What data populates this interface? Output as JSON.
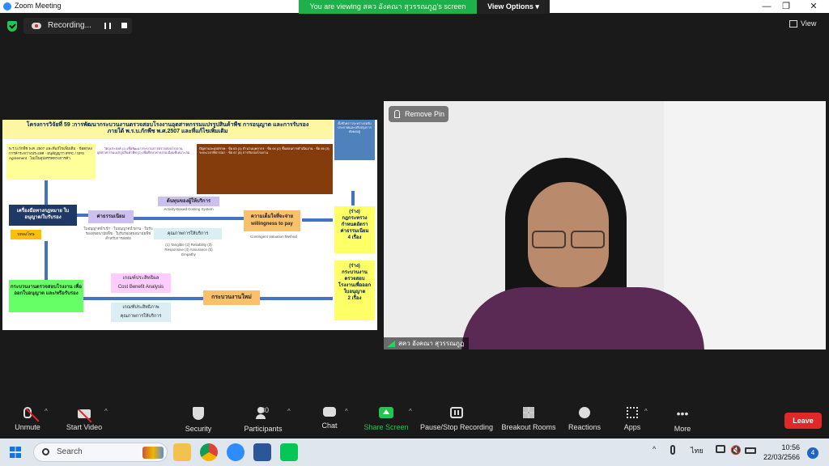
{
  "titlebar": {
    "app_title": "Zoom Meeting",
    "viewing_banner": "You are viewing สคว อังคณา สุวรรณภูฏ's screen",
    "view_options": "View Options",
    "minimize": "—",
    "maximize": "❐",
    "close": "✕"
  },
  "topbar": {
    "recording_label": "Recording...",
    "view_label": "View"
  },
  "slide": {
    "title_line1": "โครงการวิจัยที่ 59 :การพัฒนากระบวนงานตรวจสอบโรงงานอุตสาหกรรมแปรรูปสินค้าพืช การอนุญาต และการรับรอง",
    "title_line2": "ภายใต้ พ.ร.บ.กักพืช พ.ศ.2507 และที่แก้ไขเพิ่มเติม",
    "side_blue": "ตั้งชั่วคราวระหว่างรอรับประกาศและปรับปรุงการยังคงอยู่",
    "yellow_left": "พ.ร.บ.กักพืช พ.ศ. 2507 และที่แก้ไขเพิ่มเติม · ข้อตกลงการค้าระหว่างประเทศ · อนุสัญญาฯ IPPC / SPS Agreement · ไม่เป็นอุปสรรคทางการค้า",
    "objectives": "วัตถุประสงค์ (1) เพื่อพัฒนากระบวนการตรวจสอบโรงงานอุตสาหกรรมแปรรูปสินค้าพืช (2) เพื่อศึกษาค่าธรรมเนียมที่เหมาะสม",
    "problems": "ปัญหาและอุปสรรค · ข้อ 63 (1) จำนวนบุคลากร · ข้อ 64 (2) ขั้นตอนการดำเนินงาน · ข้อ 65 (3) ระยะเวลาพิจารณา · ข้อ 67 (5) การรับรองโรงงาน",
    "law_tool": "เครื่องมือทางกฎหมาย ใบอนุญาต/ใบรับรอง",
    "amend": "บทลงโทษ",
    "fee": "ค่าธรรมเนียม",
    "fee_sub": "ใบอนุญาตนำเข้า · ใบอนุญาตนำผ่าน · ใบรับรองสุขอนามัยพืช · ใบรับรองสุขอนามัยพืชสำหรับการส่งต่อ",
    "abc": "ต้นทุนของผู้ให้บริการ",
    "abc_sub": "Activity-Based Costing System",
    "service": "คุณภาพการให้บริการ",
    "service_sub": "(1) Tangible (2) Reliability (3) Responsive (4) Assurance (5) Empathy",
    "wtp_line1": "ความเต็มใจที่จะจ่าย",
    "wtp_line2": "willingness to pay",
    "valuation": "Contingent Valuation Method",
    "draft1_line1": "(ร่าง)",
    "draft1_line2": "กฎกระทรวง",
    "draft1_line3": "กำหนดอัตรา",
    "draft1_line4": "ค่าธรรมเนียม",
    "draft1_line5": "4 เรื่อง",
    "process_box": "กระบวนงานตรวจสอบโรงงาน เพื่อออกใบอนุญาต และ/หรือรับรอง",
    "cba_line1": "เกณฑ์ประสิทธิผล",
    "cba_line2": "Cost Benefit Analysis",
    "eff_line1": "เกณฑ์ประสิทธิภาพ",
    "eff_line2": "คุณภาพการให้บริการ",
    "new_process": "กระบวนงานใหม่",
    "draft2_line1": "(ร่าง)",
    "draft2_line2": "กระบวนงาน",
    "draft2_line3": "ตรวจสอบ",
    "draft2_line4": "โรงงานเพื่อออก",
    "draft2_line5": "ใบอนุญาต",
    "draft2_line6": "2 เรื่อง"
  },
  "video": {
    "remove_pin": "Remove Pin",
    "participant_name": "สคว อังคณา สุวรรณภูฏ"
  },
  "toolbar": {
    "unmute": "Unmute",
    "start_video": "Start Video",
    "security": "Security",
    "participants": "Participants",
    "participants_count": "30",
    "chat": "Chat",
    "share_screen": "Share Screen",
    "recording": "Pause/Stop Recording",
    "breakout": "Breakout Rooms",
    "reactions": "Reactions",
    "apps": "Apps",
    "more": "More",
    "leave": "Leave",
    "caret": "^"
  },
  "taskbar": {
    "search_placeholder": "Search",
    "lang": "ไทย",
    "time": "10:56",
    "date": "22/03/2566",
    "notifications": "4",
    "tray_chevron": "^"
  },
  "colors": {
    "share_green": "#23c552",
    "leave_red": "#e02828",
    "viewing_banner_green": "#1eb04a",
    "zoom_blue": "#2d8cff"
  }
}
